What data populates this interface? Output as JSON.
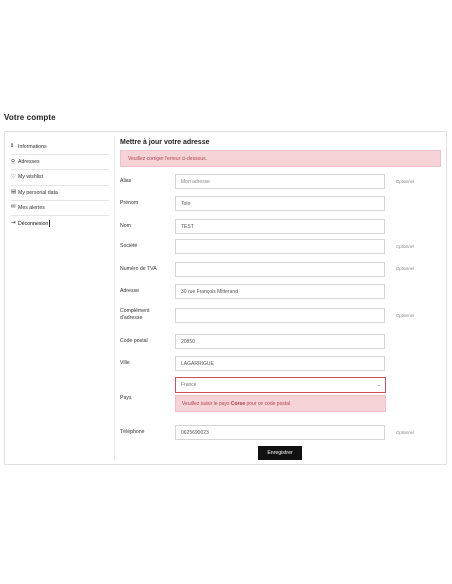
{
  "page_title": "Votre compte",
  "sidebar": {
    "items": [
      {
        "icon": "info-icon",
        "glyph": "ℹ",
        "label": "Informations"
      },
      {
        "icon": "map-pin-icon",
        "glyph": "⚲",
        "label": "Adresses"
      },
      {
        "icon": "heart-icon",
        "glyph": "♡",
        "label": "My wishlist"
      },
      {
        "icon": "document-icon",
        "glyph": "▤",
        "label": "My personal data"
      },
      {
        "icon": "mail-icon",
        "glyph": "✉",
        "label": "Mes alertes"
      },
      {
        "icon": "logout-icon",
        "glyph": "⇥",
        "label": "Déconnexion"
      }
    ]
  },
  "form": {
    "title": "Mettre à jour votre adresse",
    "error_banner": "Veuillez corriger l'erreur ci-dessous.",
    "optional_label": "Optionnel",
    "fields": {
      "alias": {
        "label": "Alias",
        "placeholder": "Mon adresse"
      },
      "firstname": {
        "label": "Prénom",
        "value": "Toto"
      },
      "lastname": {
        "label": "Nom",
        "value": "TEST"
      },
      "company": {
        "label": "Société",
        "value": ""
      },
      "vat": {
        "label": "Numéro de TVA",
        "value": ""
      },
      "address": {
        "label": "Adresse",
        "value": "30 rue François Mitterand"
      },
      "address2": {
        "label_line1": "Complément",
        "label_line2": "d'adresse",
        "value": ""
      },
      "postcode": {
        "label": "Code postal",
        "value": "20850"
      },
      "city": {
        "label": "Ville",
        "value": "LAGARRIGUE"
      },
      "country": {
        "label": "Pays",
        "selected": "France"
      },
      "phone": {
        "label": "Téléphone",
        "value": "0625690023"
      }
    },
    "country_error_prefix": "Veuillez saisir le pays ",
    "country_error_bold": "Corse",
    "country_error_suffix": " pour ce code postal",
    "submit_label": "Enregistrer"
  },
  "colors": {
    "error_bg": "#f5d3d7",
    "error_text": "#b0464f",
    "button_bg": "#111111"
  }
}
